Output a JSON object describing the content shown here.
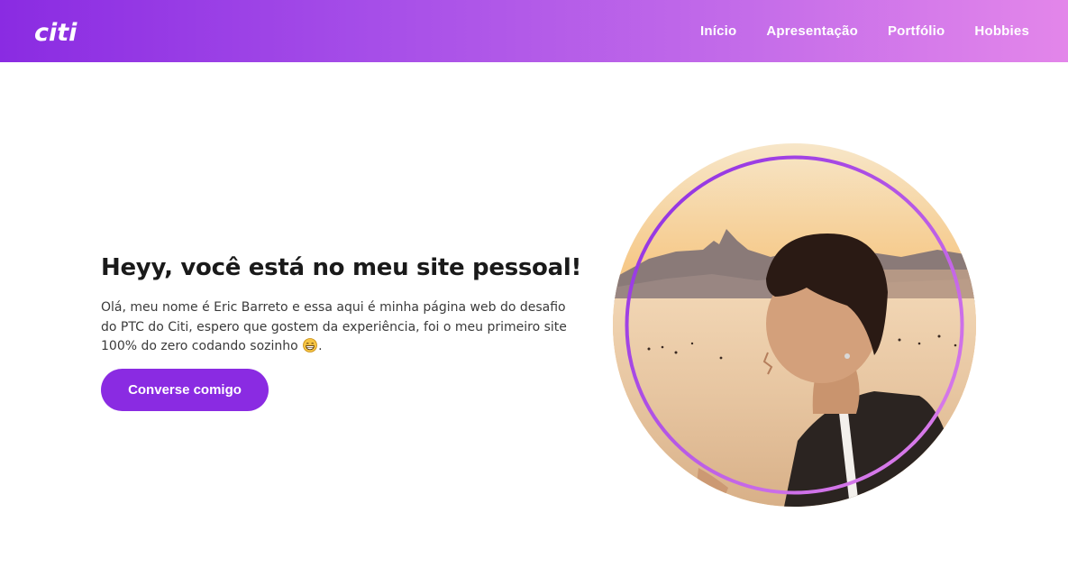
{
  "brand": {
    "logo_text": "citi",
    "accent_color": "#8a2be2",
    "gradient_end": "#e386ea"
  },
  "nav": {
    "items": [
      {
        "label": "Início"
      },
      {
        "label": "Apresentação"
      },
      {
        "label": "Portfólio"
      },
      {
        "label": "Hobbies"
      }
    ]
  },
  "hero": {
    "title": "Heyy, você está no meu site pessoal!",
    "text_part1": "Olá, meu nome é Eric Barreto e essa aqui é minha página web do desafio do PTC do Citi, espero que gostem da experiência, foi o meu primeiro site 100% do zero codando sozinho",
    "text_part2": ".",
    "emoji_icon": "grinning-face-icon",
    "cta_label": "Converse comigo"
  },
  "profile": {
    "photo_icon": "profile-photo",
    "ring_color": "#a04de6"
  }
}
